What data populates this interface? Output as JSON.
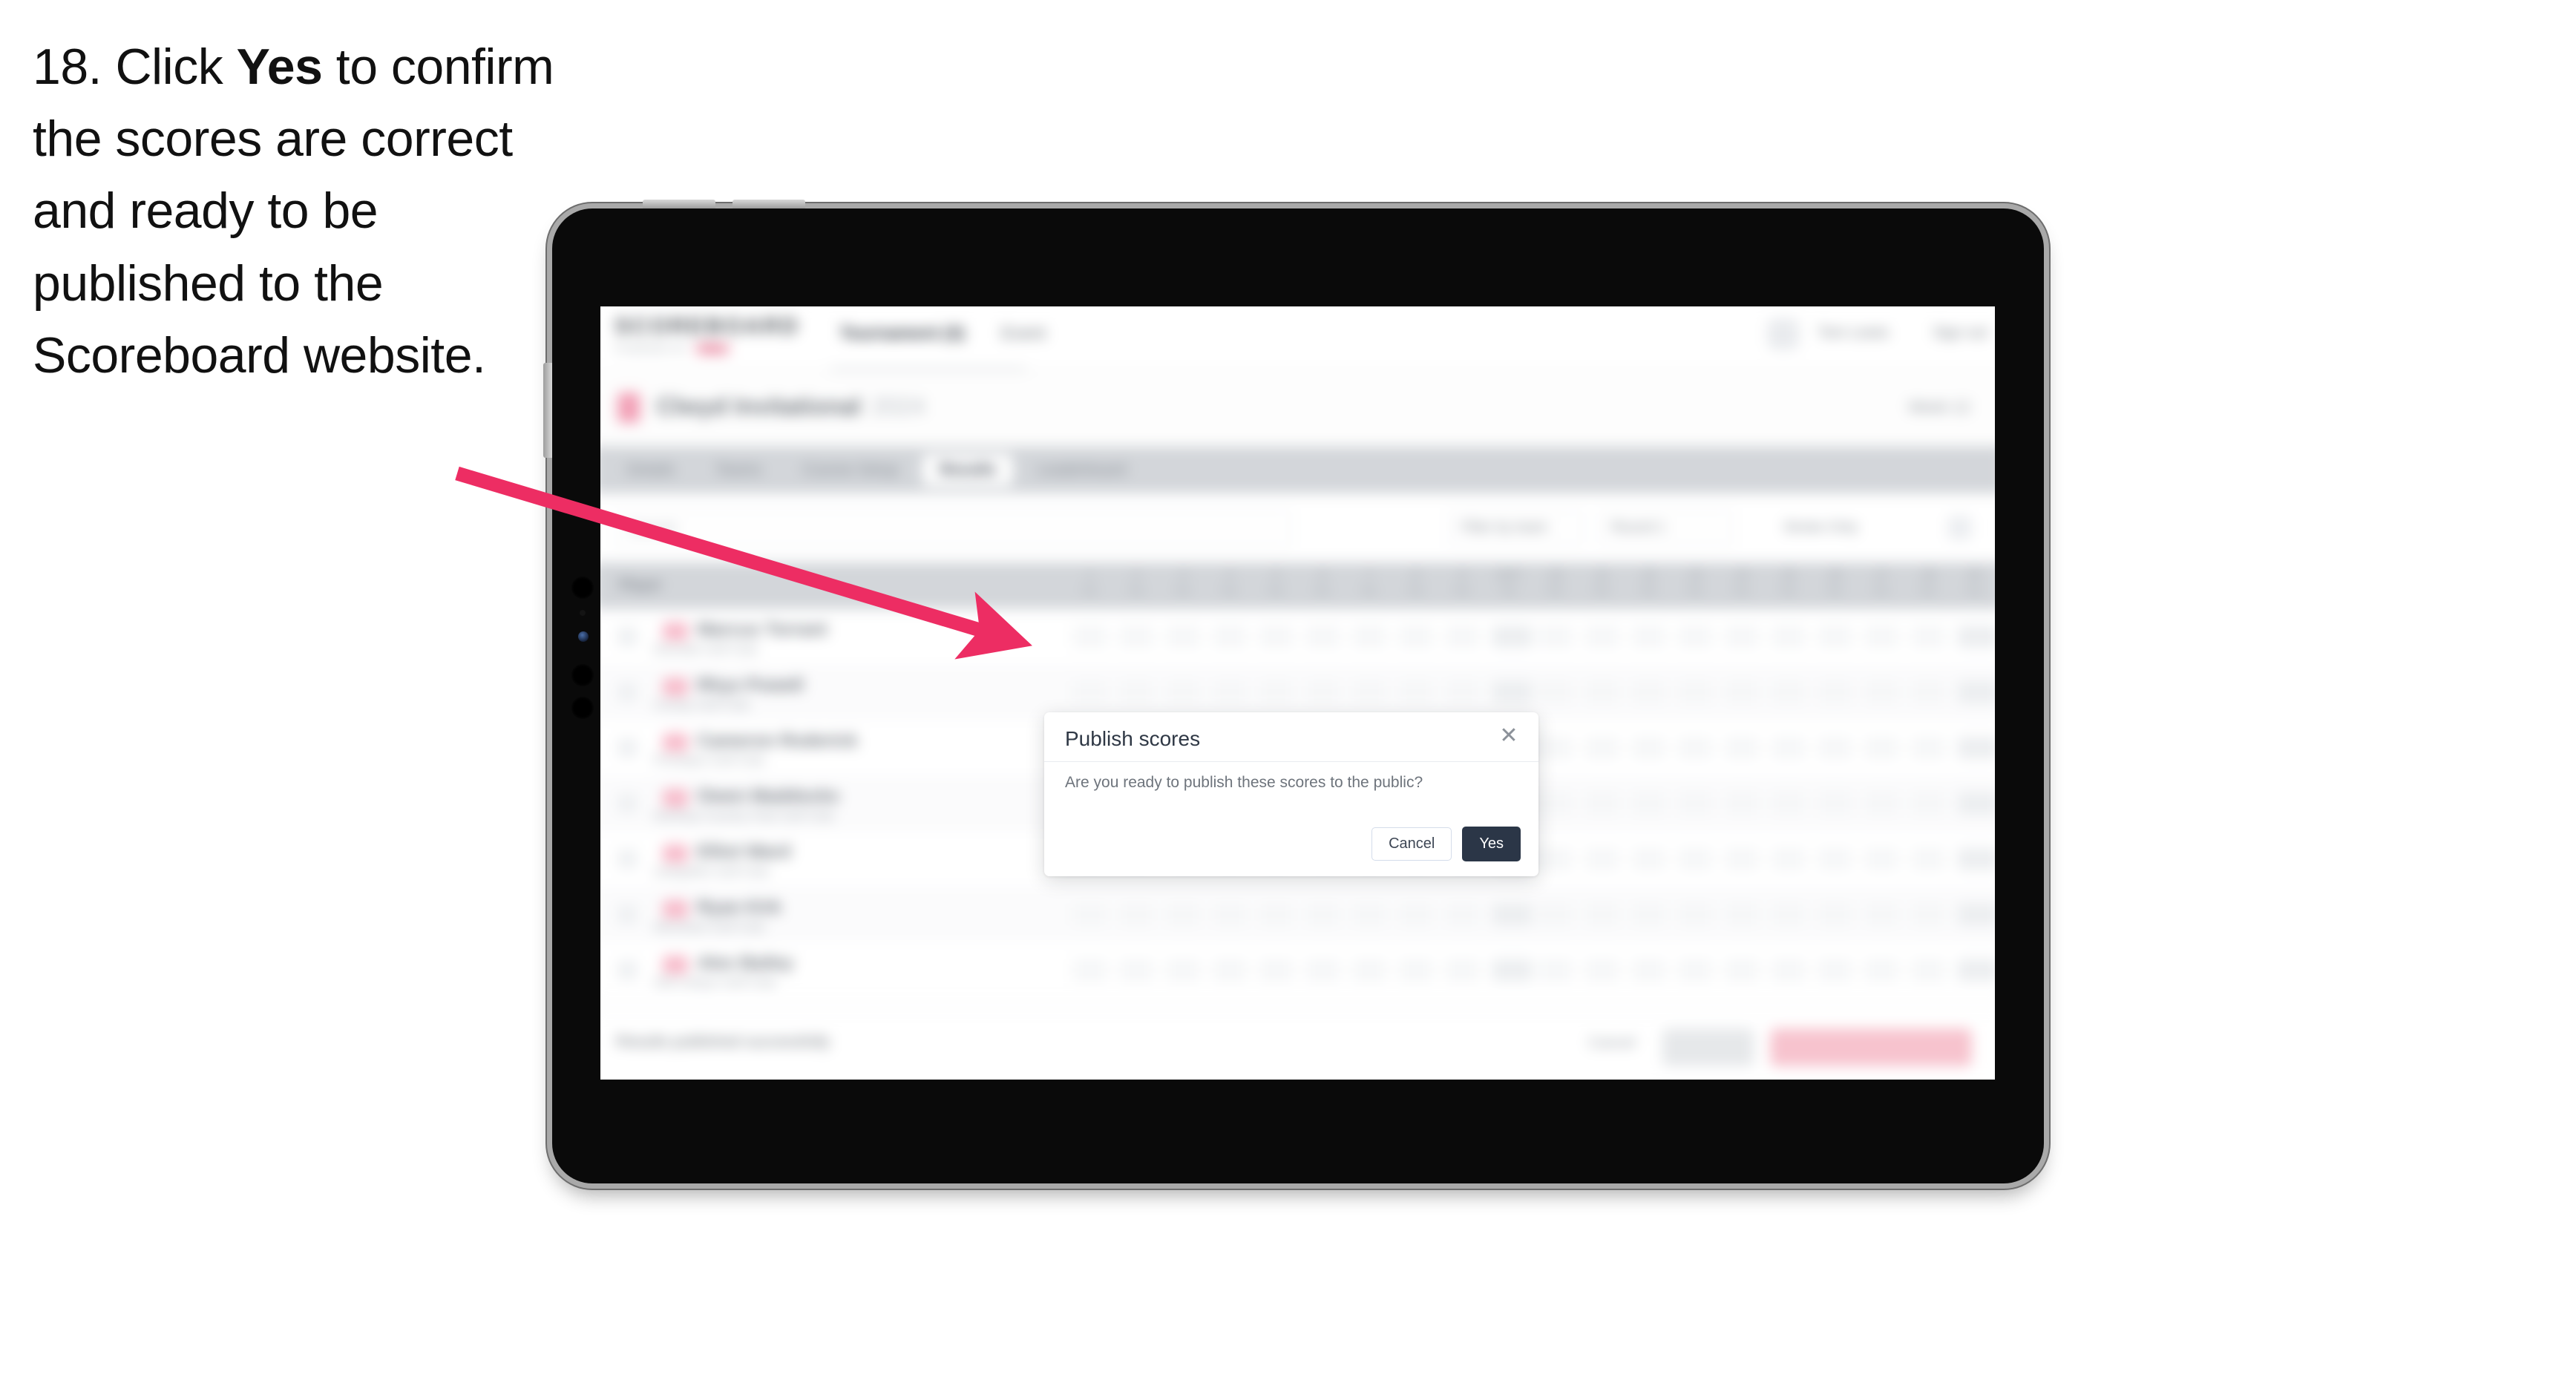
{
  "instruction": {
    "number": "18.",
    "lead": "Click ",
    "bold": "Yes",
    "rest": " to confirm the scores are correct and ready to be published to the Scoreboard website."
  },
  "colors": {
    "arrow": "#ED2D63",
    "primary_button": "#2B3647",
    "tablet_body": "#0A0A0A",
    "tablet_frame": "#A9A9A9",
    "accent_pink": "#F2A0B6"
  },
  "modal": {
    "title": "Publish scores",
    "body": "Are you ready to publish these scores to the public?",
    "close_icon": "close-icon",
    "cancel_label": "Cancel",
    "yes_label": "Yes"
  },
  "app": {
    "brand": "SCOREBOARD",
    "brand_sub": "POWERED BY",
    "brand_pill": "PGA",
    "topnav": [
      {
        "label": "Tournament (3)",
        "active": true
      },
      {
        "label": "Event",
        "active": false
      }
    ],
    "user_name": "Tom Lewis",
    "sign_out": "Sign out",
    "sub_title": "Clwyd Invitational",
    "sub_title_muted": "2024",
    "sub_right": "Week 12",
    "tabs": [
      {
        "label": "Details",
        "active": false
      },
      {
        "label": "Teams",
        "active": false
      },
      {
        "label": "Course Setup",
        "active": false
      },
      {
        "label": "Results",
        "active": true
      },
      {
        "label": "Leaderboard",
        "active": false
      }
    ],
    "search_placeholder": "Search",
    "filters": [
      "Filter by team",
      "Round 1",
      "Stroke Only"
    ],
    "table": {
      "player_header": "Player",
      "hole_headers": [
        "1",
        "2",
        "3",
        "4",
        "5",
        "6",
        "7",
        "8",
        "9",
        "OUT",
        "10",
        "11",
        "12",
        "13",
        "14",
        "15",
        "16",
        "17",
        "18",
        "IN"
      ],
      "par_sub": "Par",
      "total_header": "Total",
      "score_header": "Score",
      "rows": [
        {
          "name": "Marcus Torrant",
          "club": "Deeside Golf Club"
        },
        {
          "name": "Rhys Powell",
          "club": "Conwy Golf Club"
        },
        {
          "name": "Cameron Roderick",
          "club": "Prestatyn Golf Club"
        },
        {
          "name": "Owen Maddocks",
          "club": "Northop Country Park Golf Club"
        },
        {
          "name": "Elliot Ward",
          "club": "Llangollen Golf Club"
        },
        {
          "name": "Ryan Kirk",
          "club": "Wrexham Golf Club"
        },
        {
          "name": "Alex Bailey",
          "club": "Old Colwyn Golf Club"
        }
      ]
    },
    "footer_note": "Results published successfully",
    "footer_link": "Cancel",
    "footer_btn_grey": "Save all",
    "footer_btn_pink": "Publish scores to public"
  }
}
